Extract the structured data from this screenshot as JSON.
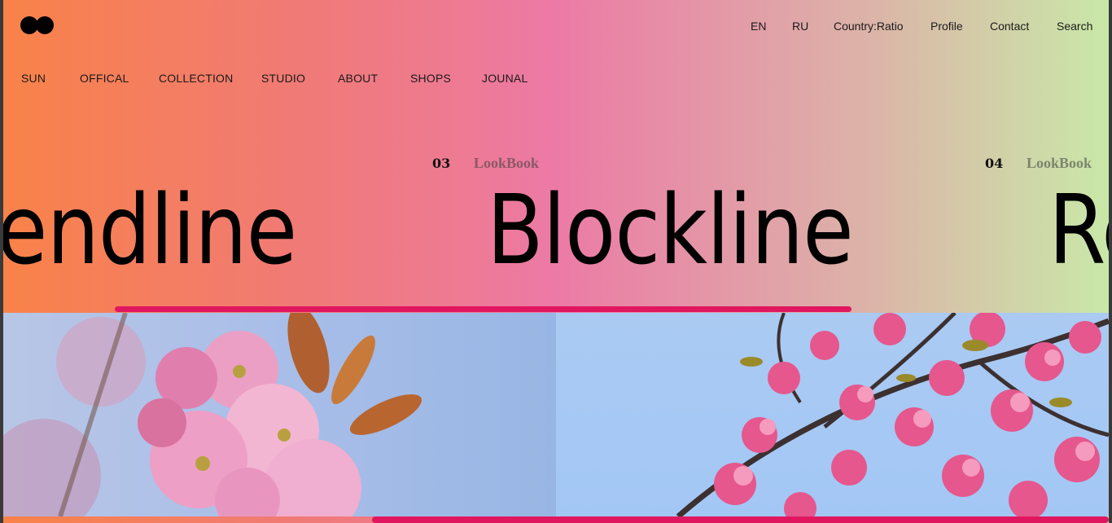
{
  "top_nav": {
    "items": [
      "EN",
      "RU",
      "Country:Ratio",
      "Profile",
      "Contact",
      "Search"
    ]
  },
  "main_nav": {
    "items": [
      "SUN",
      "OFFICAL",
      "COLLECTION",
      "STUDIO",
      "ABOUT",
      "SHOPS",
      "JOUNAL"
    ]
  },
  "slides": [
    {
      "number": "",
      "tag": "",
      "title": "endline"
    },
    {
      "number": "03",
      "tag": "LookBook",
      "title": "Blockline"
    },
    {
      "number": "04",
      "tag": "LookBook",
      "title": "Re"
    }
  ],
  "progress": {
    "fraction": 0.67
  },
  "colors": {
    "accent": "#e0175f",
    "gradient_start": "#f98249",
    "gradient_mid": "#ec7aa6",
    "gradient_end": "#c9e8a8"
  },
  "images": [
    {
      "name": "cherry-blossom-closeup-photo"
    },
    {
      "name": "cherry-blossom-branches-photo"
    }
  ]
}
